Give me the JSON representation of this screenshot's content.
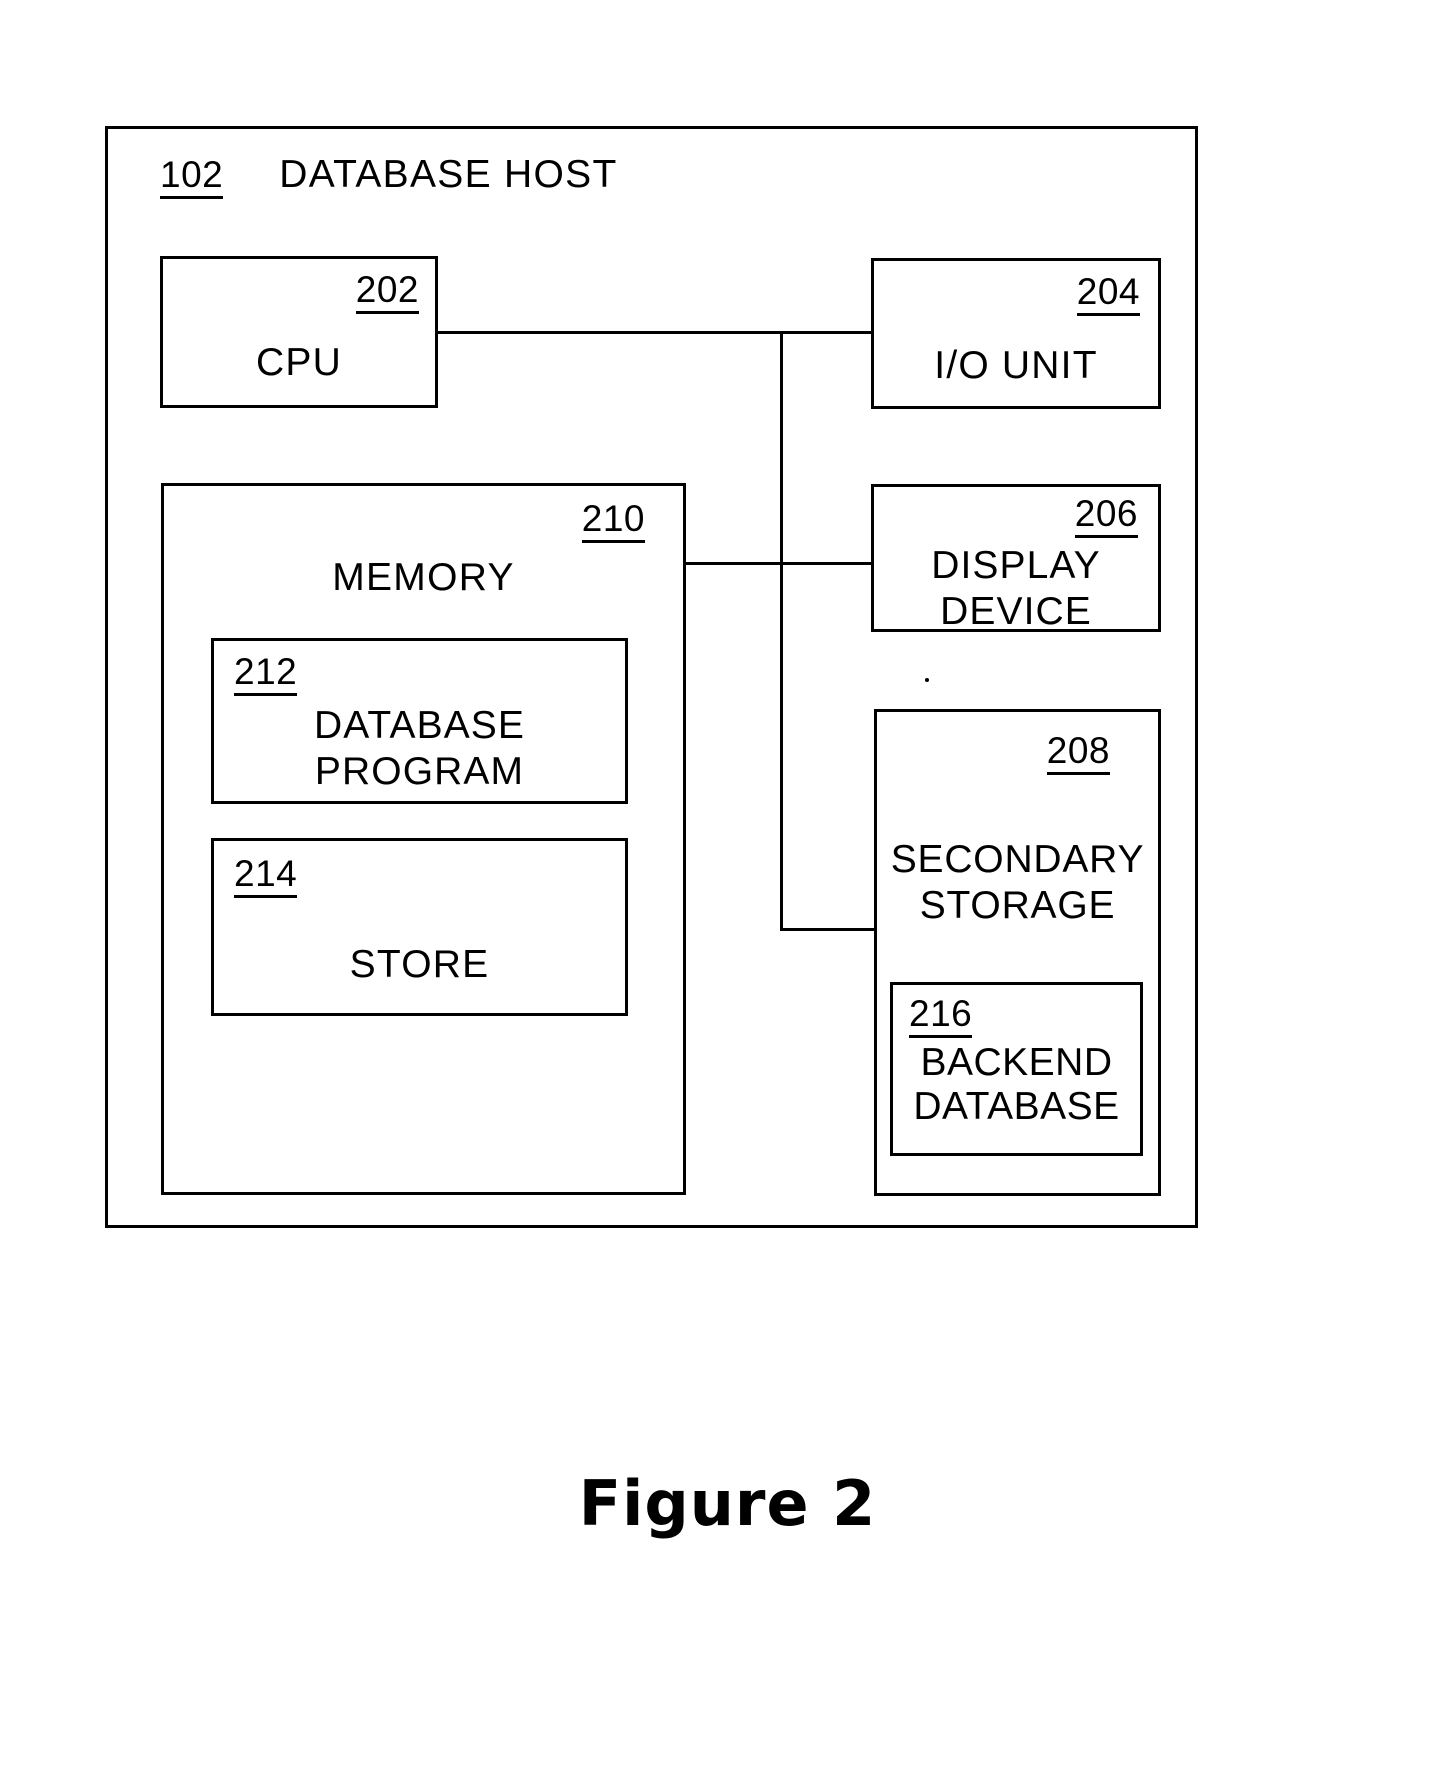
{
  "figure": {
    "caption": "Figure 2"
  },
  "host": {
    "ref": "102",
    "label": "DATABASE HOST"
  },
  "blocks": {
    "cpu": {
      "ref": "202",
      "label": "CPU"
    },
    "io_unit": {
      "ref": "204",
      "label": "I/O UNIT"
    },
    "memory": {
      "ref": "210",
      "label": "MEMORY"
    },
    "database_program": {
      "ref": "212",
      "line1": "DATABASE",
      "line2": "PROGRAM"
    },
    "store": {
      "ref": "214",
      "label": "STORE"
    },
    "display_device": {
      "ref": "206",
      "line1": "DISPLAY",
      "line2": "DEVICE"
    },
    "secondary_storage": {
      "ref": "208",
      "line1": "SECONDARY",
      "line2": "STORAGE"
    },
    "backend_database": {
      "ref": "216",
      "line1": "BACKEND",
      "line2": "DATABASE"
    }
  },
  "colors": {
    "ink": "#000000",
    "paper": "#ffffff"
  }
}
